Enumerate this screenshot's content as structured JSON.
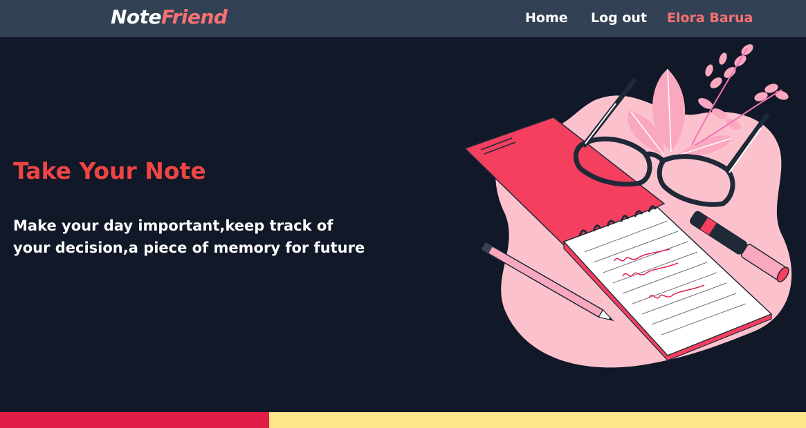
{
  "navbar": {
    "logo_part1": "Note",
    "logo_part2": "Friend",
    "links": [
      "Home",
      "Log out",
      "Elora Barua"
    ]
  },
  "hero": {
    "title": "Take Your Note",
    "text": "Make your day important,keep track of your decision,a piece of memory for future"
  },
  "colors": {
    "navbar_bg": "#334155",
    "page_bg": "#111827",
    "accent": "#f87171",
    "title_red": "#ef4444",
    "footer_red": "#e11d48",
    "footer_yellow": "#fde68a"
  },
  "illustration": {
    "icon": "notebook-glasses-pencil-illustration"
  }
}
